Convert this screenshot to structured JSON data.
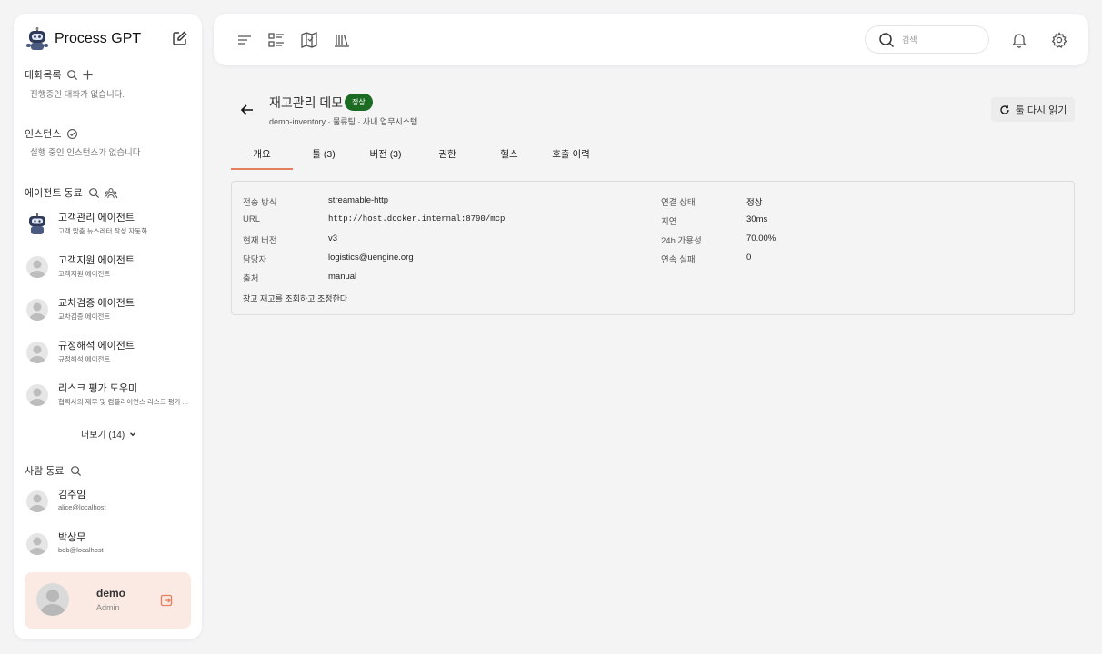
{
  "sidebar": {
    "brand": "Process GPT",
    "chat_section": {
      "title": "대화목록",
      "empty": "진행중인 대화가 없습니다."
    },
    "instance_section": {
      "title": "인스턴스",
      "empty": "실행 중인 인스턴스가 없습니다"
    },
    "agent_section": {
      "title": "에이전트 동료",
      "agents": [
        {
          "name": "고객관리 에이전트",
          "desc": "고객 맞춤 뉴스레터 작성 자동화",
          "avatar": "robot"
        },
        {
          "name": "고객지원 에이전트",
          "desc": "고객지원 에이전트",
          "avatar": "person"
        },
        {
          "name": "교차검증 에이전트",
          "desc": "교차검증 에이전트",
          "avatar": "person"
        },
        {
          "name": "규정해석 에이전트",
          "desc": "규정해석 에이전트",
          "avatar": "person"
        },
        {
          "name": "리스크 평가 도우미",
          "desc": "협력사의 재무 및 컴플라이언스 리스크 평가 ...",
          "avatar": "person"
        }
      ],
      "more": "더보기 (14)"
    },
    "people_section": {
      "title": "사람 동료",
      "people": [
        {
          "name": "김주임",
          "email": "alice@localhost"
        },
        {
          "name": "박상무",
          "email": "bob@localhost"
        }
      ]
    },
    "user": {
      "name": "demo",
      "role": "Admin"
    }
  },
  "topbar": {
    "search_placeholder": "검색",
    "icons": [
      "menu-icon",
      "list-icon",
      "map-icon",
      "library-icon",
      "search-icon",
      "bell-icon",
      "gear-icon"
    ]
  },
  "main": {
    "title": "재고관리 데모",
    "status_badge": "정상",
    "subtitle": "demo-inventory · 물류팀 · 사내 업무시스템",
    "reload_button": "툴 다시 읽기",
    "tabs": [
      "개요",
      "툴 (3)",
      "버전 (3)",
      "권한",
      "헬스",
      "호출 이력"
    ],
    "active_tab": 0,
    "overview": {
      "left": [
        {
          "label": "전송 방식",
          "value": "streamable-http"
        },
        {
          "label": "URL",
          "value": "http://host.docker.internal:8790/mcp"
        },
        {
          "label": "현재 버전",
          "value": "v3"
        },
        {
          "label": "담당자",
          "value": "logistics@uengine.org"
        },
        {
          "label": "출처",
          "value": "manual"
        }
      ],
      "right": [
        {
          "label": "연결 상태",
          "value": "정상"
        },
        {
          "label": "지연",
          "value": "30ms"
        },
        {
          "label": "24h 가용성",
          "value": "70.00%"
        },
        {
          "label": "연속 실패",
          "value": "0"
        }
      ],
      "description": "창고 재고를 조회하고 조정한다"
    }
  },
  "colors": {
    "accent": "#e57f5f",
    "status_ok": "#1b6b22",
    "user_card_bg": "#fbe9e3"
  }
}
